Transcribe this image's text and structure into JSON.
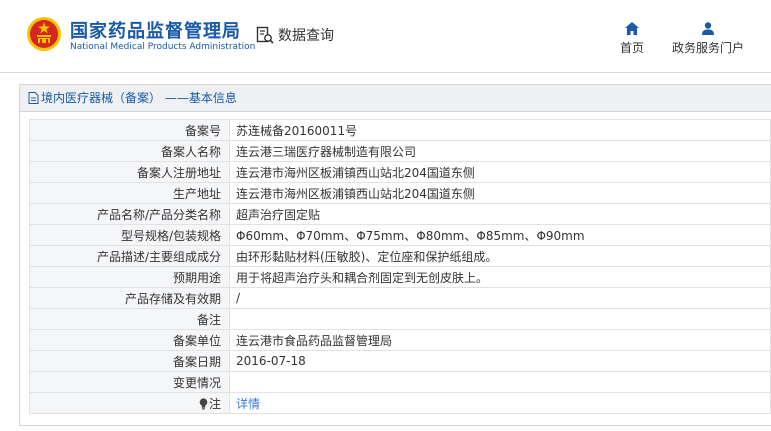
{
  "header": {
    "brand_cn": "国家药品监督管理局",
    "brand_en": "National Medical Products Administration",
    "query_label": "数据查询",
    "nav_home": "首页",
    "nav_portal": "政务服务门户"
  },
  "panel": {
    "title": "境内医疗器械（备案） ——基本信息"
  },
  "rows": [
    {
      "label": "备案号",
      "value": "苏连械备20160011号"
    },
    {
      "label": "备案人名称",
      "value": "连云港三瑞医疗器械制造有限公司"
    },
    {
      "label": "备案人注册地址",
      "value": "连云港市海州区板浦镇西山站北204国道东侧"
    },
    {
      "label": "生产地址",
      "value": "连云港市海州区板浦镇西山站北204国道东侧"
    },
    {
      "label": "产品名称/产品分类名称",
      "value": "超声治疗固定贴"
    },
    {
      "label": "型号规格/包装规格",
      "value": "Φ60mm、Φ70mm、Φ75mm、Φ80mm、Φ85mm、Φ90mm"
    },
    {
      "label": "产品描述/主要组成成分",
      "value": "由环形黏贴材料(压敏胶)、定位座和保护纸组成。"
    },
    {
      "label": "预期用途",
      "value": "用于将超声治疗头和耦合剂固定到无创皮肤上。"
    },
    {
      "label": "产品存储及有效期",
      "value": "/"
    },
    {
      "label": "备注",
      "value": ""
    },
    {
      "label": "备案单位",
      "value": "连云港市食品药品监督管理局"
    },
    {
      "label": "备案日期",
      "value": "2016-07-18"
    },
    {
      "label": "变更情况",
      "value": ""
    },
    {
      "label": "注",
      "value": "详情"
    }
  ],
  "icons": {
    "logo": "national-emblem-icon",
    "query": "search-document-icon",
    "home": "home-icon",
    "portal": "user-icon",
    "panel": "document-icon",
    "note": "lightbulb-icon"
  },
  "colors": {
    "brand": "#1a5aa6",
    "link": "#3a7bd5",
    "emblem_red": "#d7261e",
    "emblem_gold": "#f5c400"
  }
}
